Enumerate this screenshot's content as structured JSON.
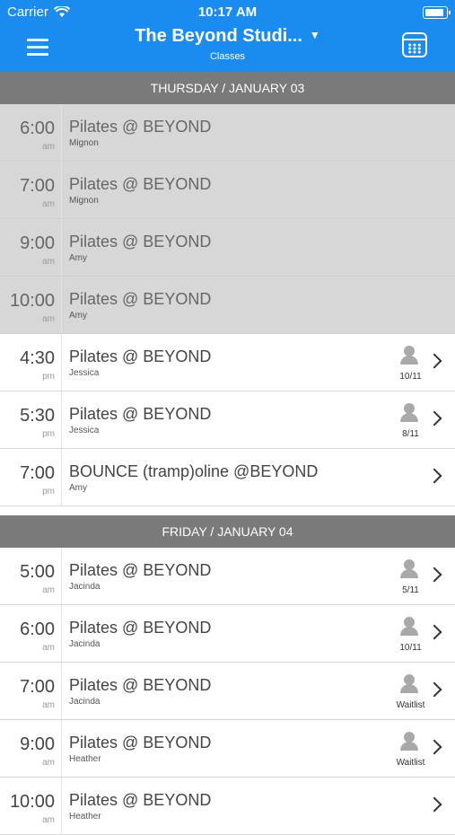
{
  "status": {
    "carrier": "Carrier",
    "time": "10:17 AM"
  },
  "header": {
    "title": "The Beyond Studi...",
    "subtitle": "Classes"
  },
  "days": [
    {
      "label": "THURSDAY / JANUARY 03",
      "classes": [
        {
          "time": "6:00",
          "ampm": "am",
          "name": "Pilates @ BEYOND",
          "instructor": "Mignon",
          "count": "",
          "past": true
        },
        {
          "time": "7:00",
          "ampm": "am",
          "name": "Pilates @ BEYOND",
          "instructor": "Mignon",
          "count": "",
          "past": true
        },
        {
          "time": "9:00",
          "ampm": "am",
          "name": "Pilates @ BEYOND",
          "instructor": "Amy",
          "count": "",
          "past": true
        },
        {
          "time": "10:00",
          "ampm": "am",
          "name": "Pilates @ BEYOND",
          "instructor": "Amy",
          "count": "",
          "past": true
        },
        {
          "time": "4:30",
          "ampm": "pm",
          "name": "Pilates @ BEYOND",
          "instructor": "Jessica",
          "count": "10/11",
          "past": false
        },
        {
          "time": "5:30",
          "ampm": "pm",
          "name": "Pilates @ BEYOND",
          "instructor": "Jessica",
          "count": "8/11",
          "past": false
        },
        {
          "time": "7:00",
          "ampm": "pm",
          "name": "BOUNCE (tramp)oline @BEYOND",
          "instructor": "Amy",
          "count": "",
          "past": false
        }
      ]
    },
    {
      "label": "FRIDAY / JANUARY 04",
      "classes": [
        {
          "time": "5:00",
          "ampm": "am",
          "name": "Pilates @ BEYOND",
          "instructor": "Jacinda",
          "count": "5/11",
          "past": false
        },
        {
          "time": "6:00",
          "ampm": "am",
          "name": "Pilates @ BEYOND",
          "instructor": "Jacinda",
          "count": "10/11",
          "past": false
        },
        {
          "time": "7:00",
          "ampm": "am",
          "name": "Pilates @ BEYOND",
          "instructor": "Jacinda",
          "count": "Waitlist",
          "past": false
        },
        {
          "time": "9:00",
          "ampm": "am",
          "name": "Pilates @ BEYOND",
          "instructor": "Heather",
          "count": "Waitlist",
          "past": false
        },
        {
          "time": "10:00",
          "ampm": "am",
          "name": "Pilates @ BEYOND",
          "instructor": "Heather",
          "count": "",
          "past": false
        }
      ]
    }
  ],
  "colors": {
    "header": "#1a8cf0",
    "day_bar": "#7a7a7a",
    "past_row": "#d7d7d7"
  }
}
